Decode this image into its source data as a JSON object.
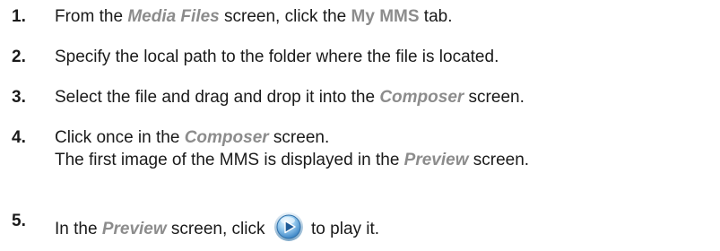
{
  "steps": [
    {
      "number": "1.",
      "t1": "From the ",
      "screen": "Media Files",
      "t2": " screen, click the ",
      "ui": "My MMS",
      "t3": " tab."
    },
    {
      "number": "2.",
      "text": "Specify the local path to the folder where the file is located."
    },
    {
      "number": "3.",
      "t1": "Select the file and drag and drop it into the ",
      "screen": "Composer",
      "t2": " screen."
    },
    {
      "number": "4.",
      "t1": "Click once in the ",
      "screen": "Composer",
      "t2": " screen.",
      "line2_t1": "The first image of the MMS is displayed in the ",
      "line2_screen": "Preview",
      "line2_t2": " screen."
    },
    {
      "number": "5.",
      "t1": "In the ",
      "screen": "Preview",
      "t2": " screen, click ",
      "icon": "play-button-icon",
      "t3": " to play it."
    }
  ]
}
